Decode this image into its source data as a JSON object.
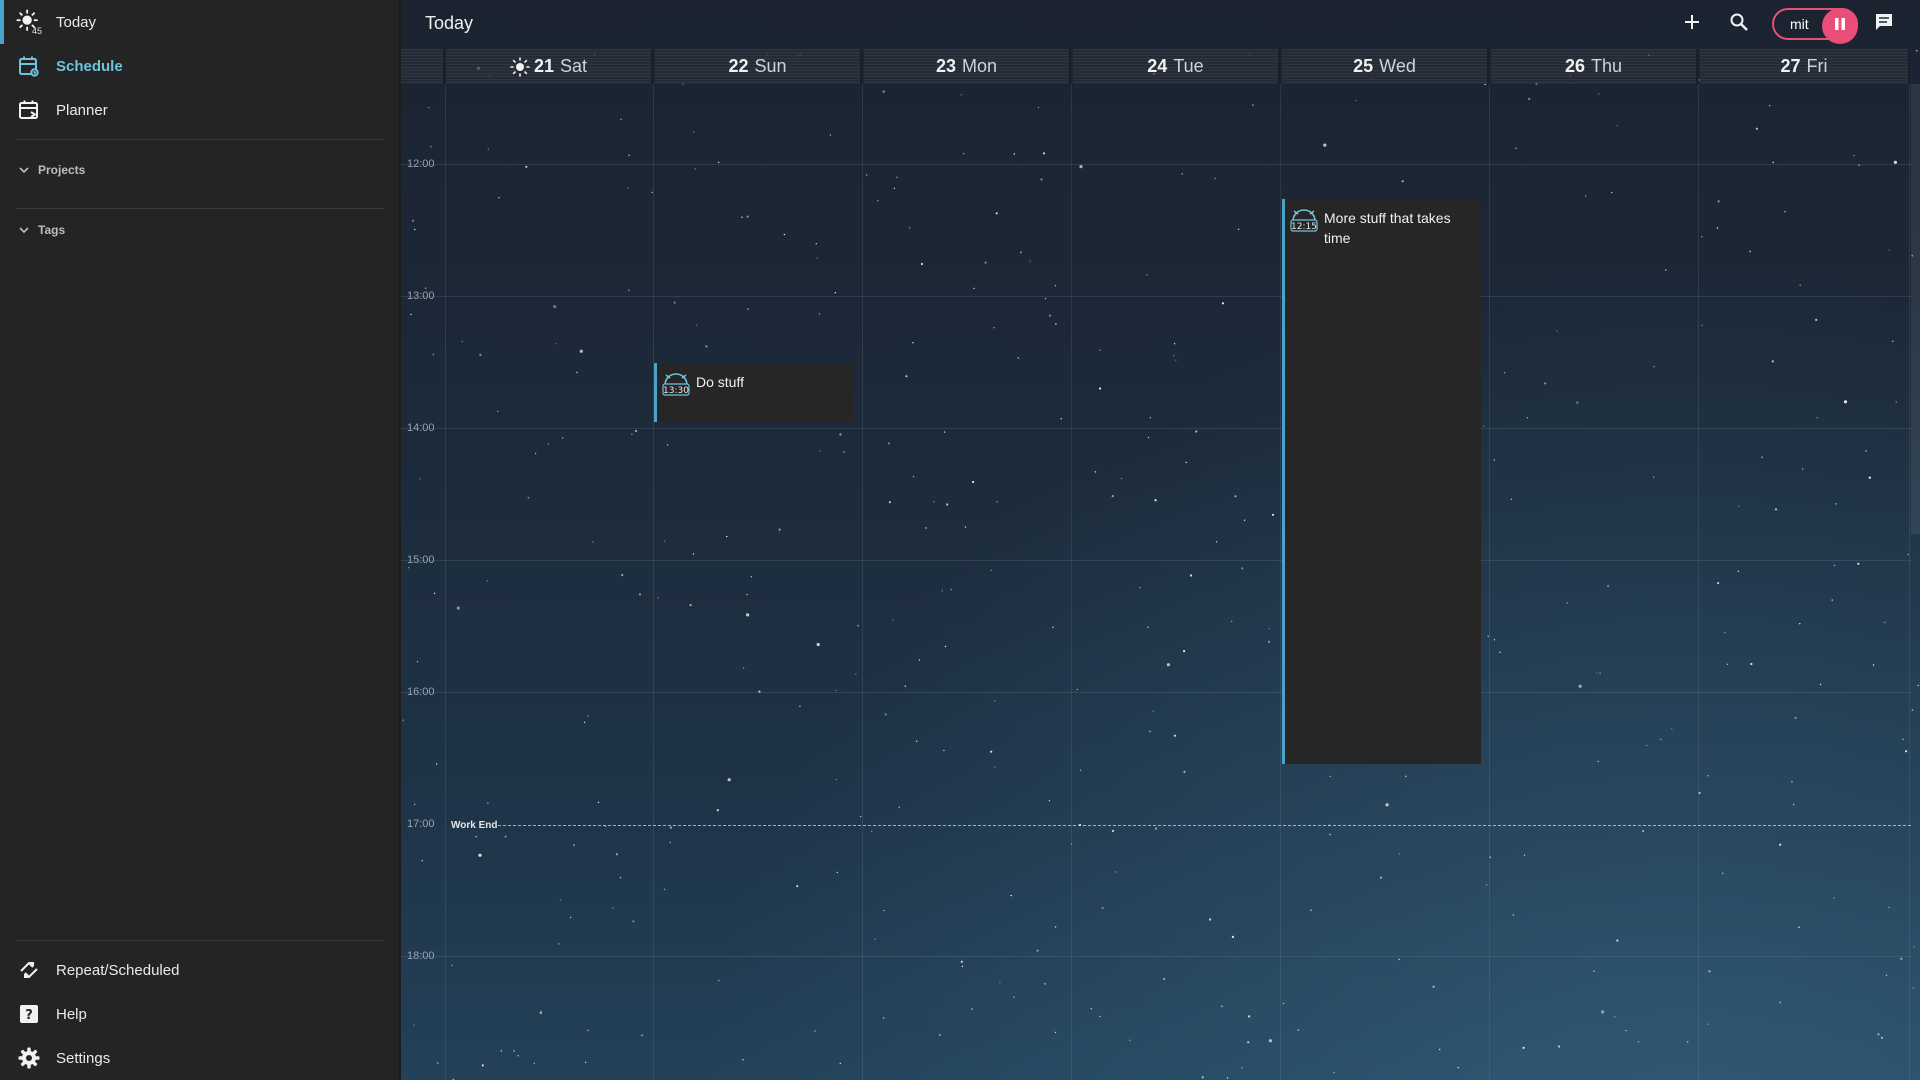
{
  "sidebar": {
    "items": [
      {
        "key": "today",
        "label": "Today",
        "icon": "sun-icon",
        "badge": "45"
      },
      {
        "key": "schedule",
        "label": "Schedule",
        "icon": "schedule-calendar-icon",
        "active": true
      },
      {
        "key": "planner",
        "label": "Planner",
        "icon": "planner-calendar-icon"
      }
    ],
    "sections": [
      {
        "label": "Projects"
      },
      {
        "label": "Tags"
      }
    ],
    "bottom": [
      {
        "label": "Repeat/Scheduled",
        "icon": "repeat-icon"
      },
      {
        "label": "Help",
        "icon": "help-icon"
      },
      {
        "label": "Settings",
        "icon": "gear-icon"
      }
    ]
  },
  "header": {
    "title": "Today",
    "focus_label": "mit",
    "actions": [
      "add-icon",
      "search-icon",
      "pause-icon",
      "chat-icon"
    ]
  },
  "days": [
    {
      "num": "21",
      "name": "Sat",
      "today": true
    },
    {
      "num": "22",
      "name": "Sun"
    },
    {
      "num": "23",
      "name": "Mon"
    },
    {
      "num": "24",
      "name": "Tue"
    },
    {
      "num": "25",
      "name": "Wed"
    },
    {
      "num": "26",
      "name": "Thu"
    },
    {
      "num": "27",
      "name": "Fri"
    }
  ],
  "times": [
    "12:00",
    "13:00",
    "14:00",
    "15:00",
    "16:00",
    "17:00",
    "18:00"
  ],
  "work_end_label": "Work End",
  "events": [
    {
      "title": "Do stuff",
      "day": "22 Sun",
      "time": "13:30"
    },
    {
      "title": "More stuff that takes time",
      "day": "25 Wed",
      "time": "12:15"
    }
  ],
  "colors": {
    "accent": "#4aa3c9",
    "focus": "#e94d78",
    "sidebar_bg": "#242424"
  }
}
